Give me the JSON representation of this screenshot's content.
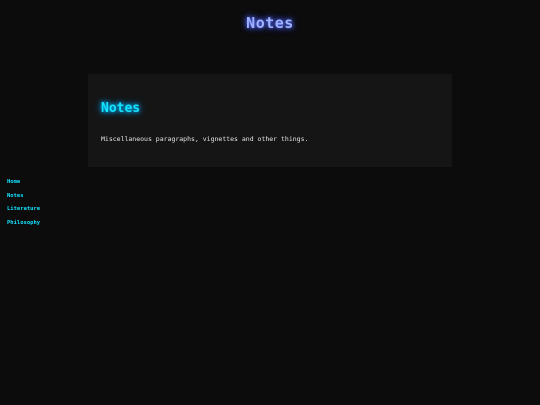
{
  "header": {
    "site_title": "Notes"
  },
  "card": {
    "title": "Notes",
    "description": "Miscellaneous paragraphs, vignettes and other things."
  },
  "nav": {
    "items": [
      {
        "label": "Home"
      },
      {
        "label": "Notes"
      },
      {
        "label": "Literature"
      },
      {
        "label": "Philosophy"
      }
    ]
  },
  "colors": {
    "background": "#0c0c0c",
    "card": "#151515",
    "accent_cyan": "#14e3ff",
    "title_blue": "#9fb2ff"
  }
}
